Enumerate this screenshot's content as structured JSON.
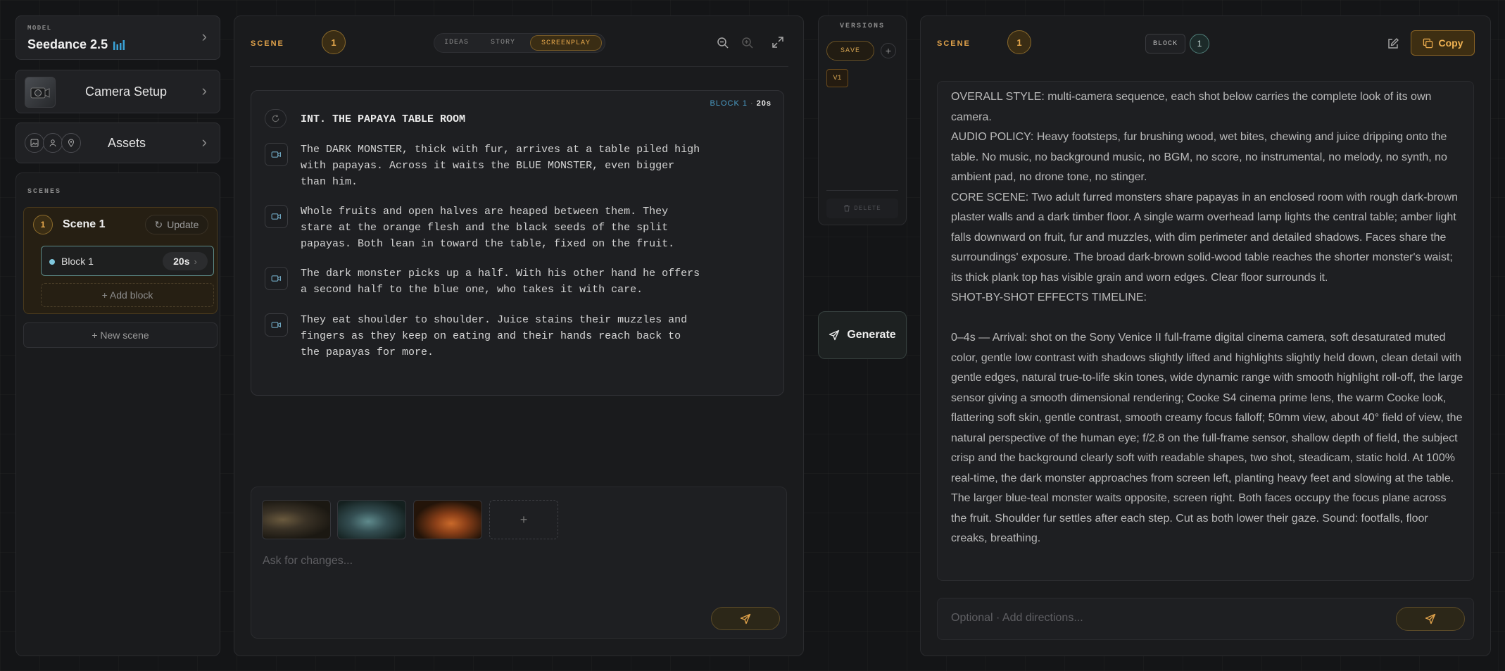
{
  "model": {
    "label": "MODEL",
    "name": "Seedance 2.5"
  },
  "camera_setup": {
    "label": "Camera Setup"
  },
  "assets": {
    "label": "Assets"
  },
  "scenes_panel": {
    "heading": "SCENES",
    "scene": {
      "number": "1",
      "title": "Scene 1",
      "update_label": "Update"
    },
    "block": {
      "label": "Block 1",
      "duration": "20s"
    },
    "add_block_label": "+ Add block",
    "new_scene_label": "+ New scene"
  },
  "editor": {
    "scene_label": "SCENE",
    "scene_number": "1",
    "tabs": [
      {
        "label": "IDEAS",
        "active": false
      },
      {
        "label": "STORY",
        "active": false
      },
      {
        "label": "SCREENPLAY",
        "active": true
      }
    ],
    "block_tag": "BLOCK 1",
    "block_duration": "20s",
    "heading": "INT. THE PAPAYA TABLE ROOM",
    "paragraphs": [
      "The DARK MONSTER, thick with fur, arrives at a table piled high\nwith papayas. Across it waits the BLUE MONSTER, even bigger\nthan him.",
      "Whole fruits and open halves are heaped between them. They\nstare at the orange flesh and the black seeds of the split\npapayas. Both lean in toward the table, fixed on the fruit.",
      "The dark monster picks up a half. With his other hand he offers\na second half to the blue one, who takes it with care.",
      "They eat shoulder to shoulder. Juice stains their muzzles and\nfingers as they keep on eating and their hands reach back to\nthe papayas for more."
    ],
    "chat_placeholder": "Ask for changes...",
    "add_reference_label": "+"
  },
  "versions": {
    "heading": "VERSIONS",
    "save_label": "SAVE",
    "add_label": "+",
    "items": [
      "V1"
    ],
    "delete_label": "DELETE"
  },
  "generate": {
    "label": "Generate"
  },
  "output": {
    "scene_label": "SCENE",
    "scene_number": "1",
    "block_label": "BLOCK",
    "block_number": "1",
    "copy_label": "Copy",
    "prompt_paragraphs": [
      "OVERALL STYLE: multi-camera sequence, each shot below carries the complete look of its own camera.",
      "AUDIO POLICY: Heavy footsteps, fur brushing wood, wet bites, chewing and juice dripping onto the table. No music, no background music, no BGM, no score, no instrumental, no melody, no synth, no ambient pad, no drone tone, no stinger.",
      "CORE SCENE: Two adult furred monsters share papayas in an enclosed room with rough dark-brown plaster walls and a dark timber floor. A single warm overhead lamp lights the central table; amber light falls downward on fruit, fur and muzzles, with dim perimeter and detailed shadows. Faces share the surroundings' exposure. The broad dark-brown solid-wood table reaches the shorter monster's waist; its thick plank top has visible grain and worn edges. Clear floor surrounds it.",
      "SHOT-BY-SHOT EFFECTS TIMELINE:",
      "",
      "0–4s — Arrival: shot on the Sony Venice II full-frame digital cinema camera, soft desaturated muted color, gentle low contrast with shadows slightly lifted and highlights slightly held down, clean detail with gentle edges, natural true-to-life skin tones, wide dynamic range with smooth highlight roll-off, the large sensor giving a smooth dimensional rendering; Cooke S4 cinema prime lens, the warm Cooke look, flattering soft skin, gentle contrast, smooth creamy focus falloff; 50mm view, about 40° field of view, the natural perspective of the human eye; f/2.8 on the full-frame sensor, shallow depth of field, the subject crisp and the background clearly soft with readable shapes, two shot, steadicam, static hold. At 100% real-time, the dark monster approaches from screen left, planting heavy feet and slowing at the table. The larger blue-teal monster waits opposite, screen right. Both faces occupy the focus plane across the fruit. Shoulder fur settles after each step. Cut as both lower their gaze. Sound: footfalls, floor creaks, breathing."
    ],
    "directions_placeholder": "Optional · Add directions..."
  }
}
